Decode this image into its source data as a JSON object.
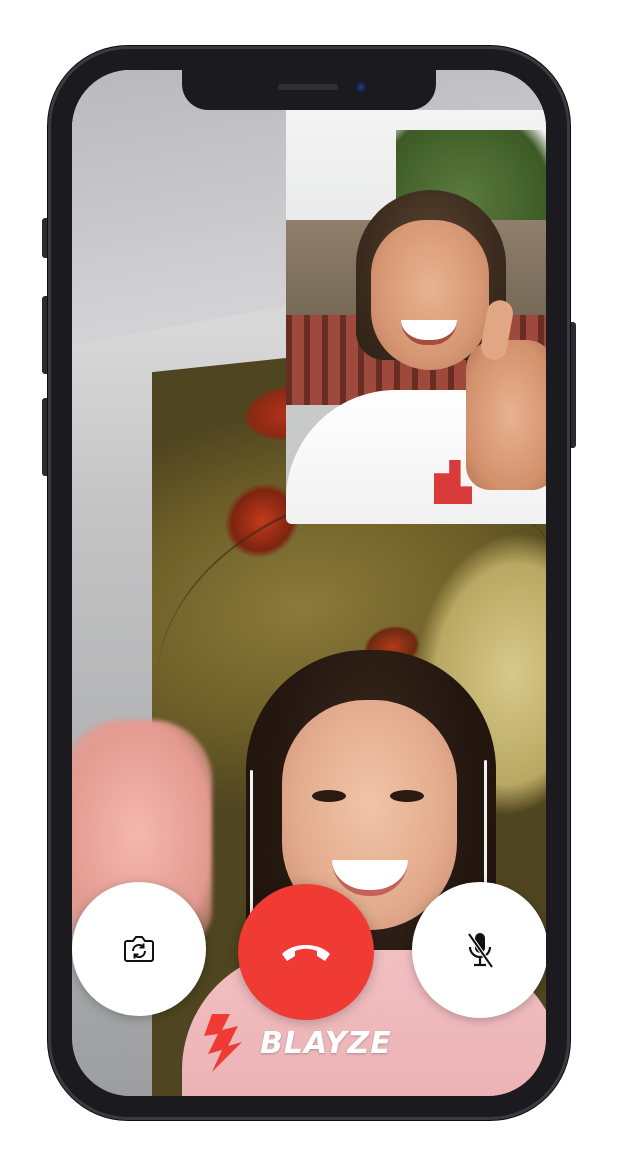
{
  "app": {
    "brand_name": "BLAYZE",
    "brand_color": "#f03a34"
  },
  "call": {
    "controls": {
      "flip_camera": {
        "icon": "flip-camera-icon"
      },
      "end_call": {
        "icon": "phone-hangup-icon",
        "color": "#f03a34"
      },
      "mute": {
        "icon": "microphone-muted-icon"
      }
    }
  }
}
